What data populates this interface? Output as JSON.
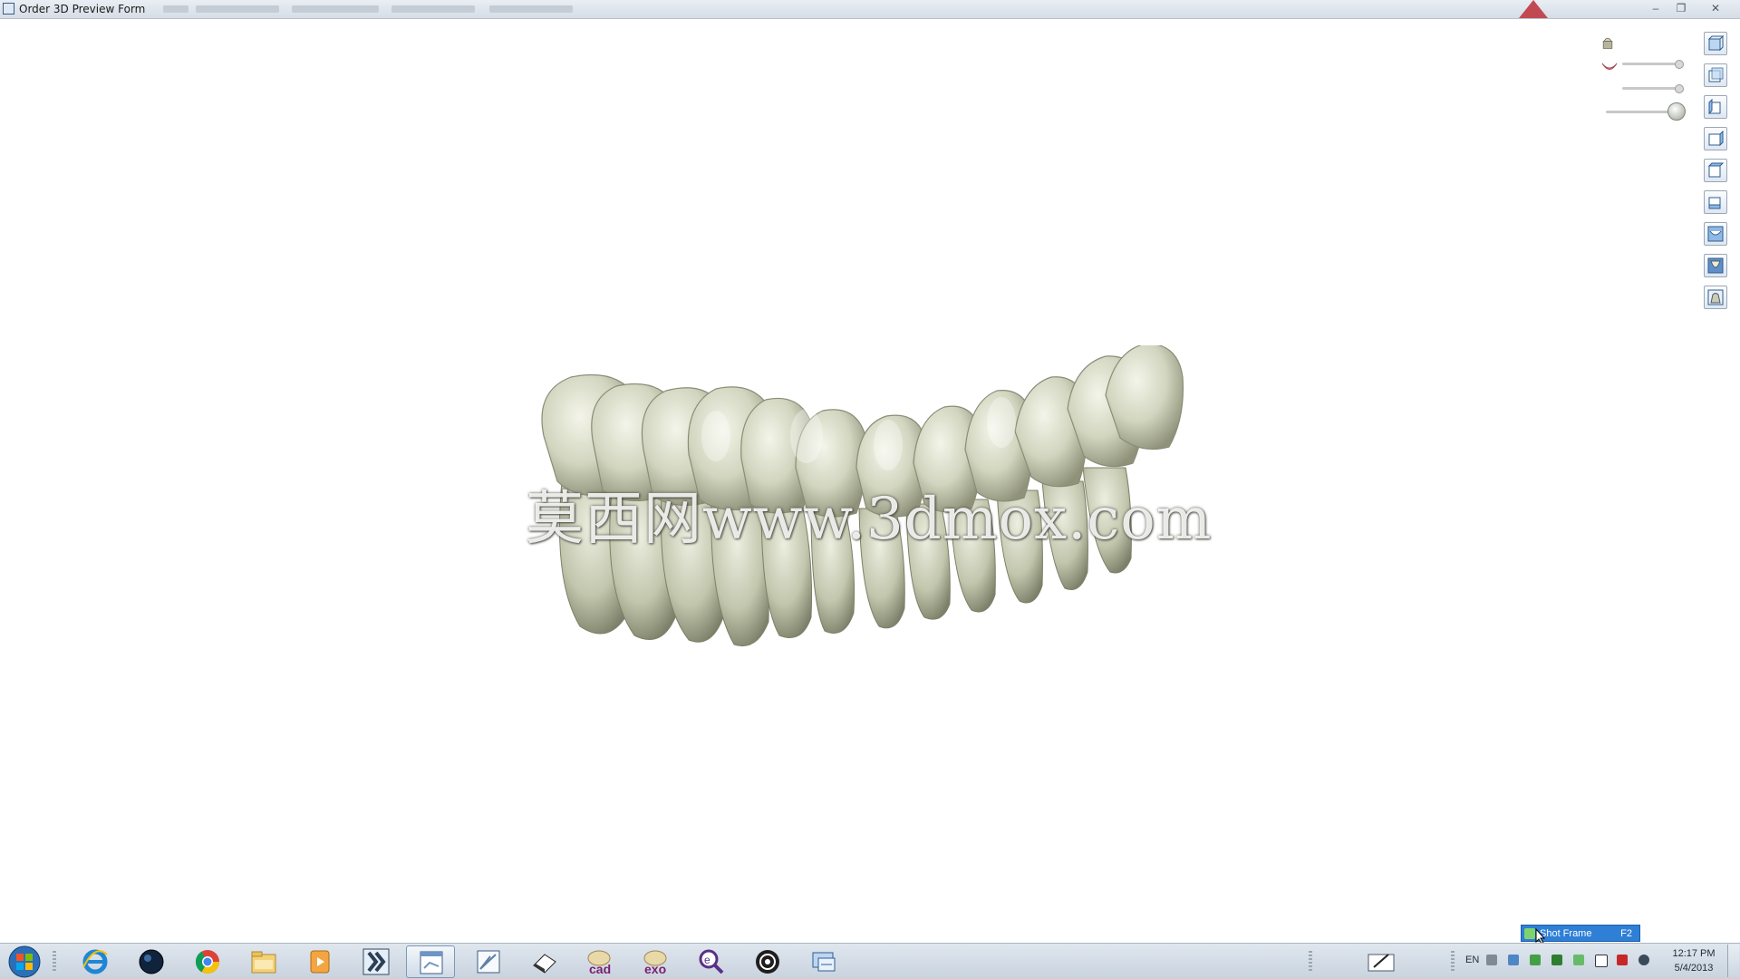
{
  "window": {
    "title": "Order 3D Preview Form",
    "minimize_glyph": "–",
    "maximize_glyph": "❐",
    "close_glyph": "✕"
  },
  "viewport": {
    "watermark": "莫西网www.3dmox.com",
    "model": "dental-arch-3d-model",
    "sliders": [
      {
        "icon": "die-icon",
        "level": 1.0
      },
      {
        "icon": "gingiva-icon",
        "level": 1.0
      },
      {
        "icon": "opacity-ball-icon",
        "level": 1.0
      }
    ],
    "view_buttons": [
      "front-view-icon",
      "back-view-icon",
      "left-view-icon",
      "right-view-icon",
      "top-view-icon",
      "bottom-view-icon",
      "upper-jaw-icon",
      "lower-jaw-icon",
      "bite-view-icon"
    ]
  },
  "notification": {
    "label": "Shot Frame",
    "shortcut": "F2"
  },
  "taskbar": {
    "apps": [
      {
        "name": "internet-explorer-icon",
        "active": false
      },
      {
        "name": "dark-orb-app-icon",
        "active": false
      },
      {
        "name": "chrome-icon",
        "active": false
      },
      {
        "name": "file-explorer-icon",
        "active": false
      },
      {
        "name": "media-player-icon",
        "active": false
      },
      {
        "name": "dental-app-icon",
        "active": false
      },
      {
        "name": "order-window-icon",
        "active": true
      },
      {
        "name": "chart-window-icon",
        "active": false
      },
      {
        "name": "eraser-app-icon",
        "active": false
      },
      {
        "name": "cad-app-icon",
        "active": false,
        "text": "cad"
      },
      {
        "name": "exo-app-icon",
        "active": false,
        "text": "exo"
      },
      {
        "name": "search-app-icon",
        "active": false
      },
      {
        "name": "disc-app-icon",
        "active": false
      },
      {
        "name": "remote-desktop-icon",
        "active": false
      }
    ],
    "tray": {
      "language": "EN",
      "time": "12:17 PM",
      "date": "5/4/2013"
    }
  },
  "colors": {
    "tooth": "#d8dac8",
    "tooth_shadow": "#8a8d76",
    "notification": "#2f7fd6"
  }
}
